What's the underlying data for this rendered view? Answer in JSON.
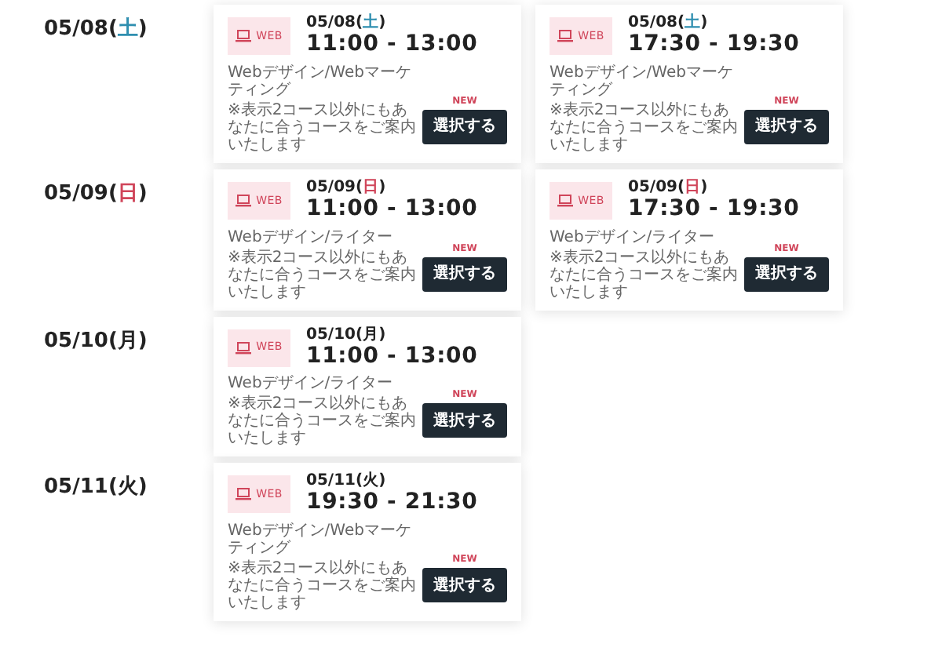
{
  "days": [
    {
      "date": "05/08",
      "weekday": "(土)",
      "color": "#2f8fb0",
      "sessions": [
        {
          "badge": "WEB",
          "date": "05/08",
          "weekday": "(土)",
          "time": "11:00 - 13:00",
          "course": "Webデザイン/Webマーケティング",
          "note": "※表示2コース以外にもあなたに合うコースをご案内いたします",
          "tag": "NEW",
          "button": "選択する"
        },
        {
          "badge": "WEB",
          "date": "05/08",
          "weekday": "(土)",
          "time": "17:30 - 19:30",
          "course": "Webデザイン/Webマーケティング",
          "note": "※表示2コース以外にもあなたに合うコースをご案内いたします",
          "tag": "NEW",
          "button": "選択する"
        }
      ]
    },
    {
      "date": "05/09",
      "weekday": "(日)",
      "color": "#d0455a",
      "sessions": [
        {
          "badge": "WEB",
          "date": "05/09",
          "weekday": "(日)",
          "time": "11:00 - 13:00",
          "course": "Webデザイン/ライター",
          "note": "※表示2コース以外にもあなたに合うコースをご案内いたします",
          "tag": "NEW",
          "button": "選択する"
        },
        {
          "badge": "WEB",
          "date": "05/09",
          "weekday": "(日)",
          "time": "17:30 - 19:30",
          "course": "Webデザイン/ライター",
          "note": "※表示2コース以外にもあなたに合うコースをご案内いたします",
          "tag": "NEW",
          "button": "選択する"
        }
      ]
    },
    {
      "date": "05/10",
      "weekday": "(月)",
      "color": "#222222",
      "sessions": [
        {
          "badge": "WEB",
          "date": "05/10",
          "weekday": "(月)",
          "time": "11:00 - 13:00",
          "course": "Webデザイン/ライター",
          "note": "※表示2コース以外にもあなたに合うコースをご案内いたします",
          "tag": "NEW",
          "button": "選択する"
        }
      ]
    },
    {
      "date": "05/11",
      "weekday": "(火)",
      "color": "#222222",
      "sessions": [
        {
          "badge": "WEB",
          "date": "05/11",
          "weekday": "(火)",
          "time": "19:30 - 21:30",
          "course": "Webデザイン/Webマーケティング",
          "note": "※表示2コース以外にもあなたに合うコースをご案内いたします",
          "tag": "NEW",
          "button": "選択する"
        }
      ]
    }
  ]
}
